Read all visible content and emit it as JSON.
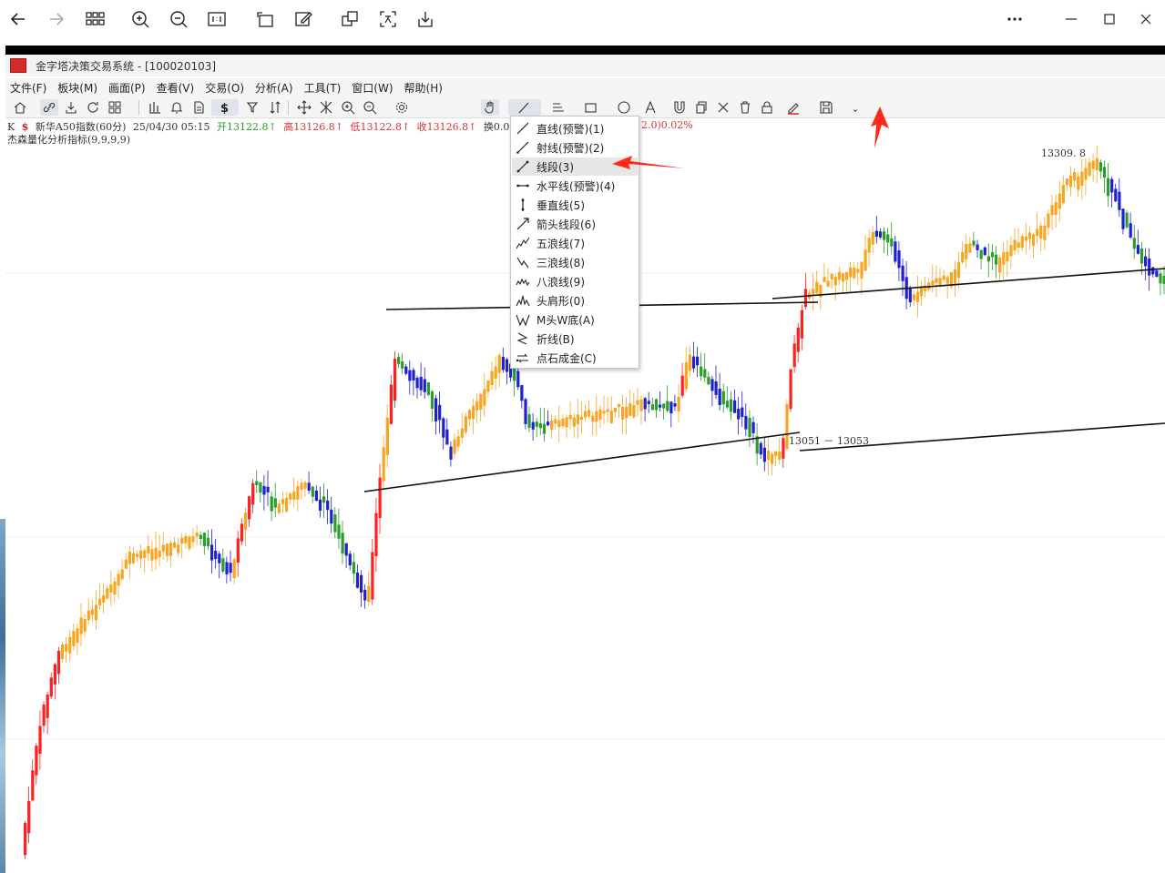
{
  "viewer": {
    "buttons": [
      "back",
      "forward",
      "grid",
      "zoom-in",
      "zoom-out",
      "actual-size",
      "rotate",
      "edit",
      "crop",
      "translate",
      "save",
      "more",
      "minimize",
      "maximize",
      "close"
    ]
  },
  "app": {
    "title": "金字塔决策交易系统 - [100020103]",
    "menu": [
      "文件(F)",
      "板块(M)",
      "画面(P)",
      "查看(V)",
      "交易(O)",
      "分析(A)",
      "工具(T)",
      "窗口(W)",
      "帮助(H)"
    ]
  },
  "info": {
    "k": "K",
    "dollar": "$",
    "name": "新华A50指数(60分)",
    "datetime": "25/04/30 05:15",
    "open": "开13122.8↑",
    "high": "高13126.8↑",
    "low": "低13122.8↑",
    "close": "收13126.8↑",
    "turnover": "换0.00%",
    "ext": "2.0)0.02%"
  },
  "indicator": "杰森量化分析指标(9,9,9,9)",
  "dropdown": {
    "items": [
      {
        "label": "直线(预警)(1)",
        "icon": "line-icon"
      },
      {
        "label": "射线(预警)(2)",
        "icon": "ray-icon"
      },
      {
        "label": "线段(3)",
        "icon": "segment-icon"
      },
      {
        "label": "水平线(预警)(4)",
        "icon": "horizontal-line-icon"
      },
      {
        "label": "垂直线(5)",
        "icon": "vertical-line-icon"
      },
      {
        "label": "箭头线段(6)",
        "icon": "arrow-segment-icon"
      },
      {
        "label": "五浪线(7)",
        "icon": "five-wave-icon"
      },
      {
        "label": "三浪线(8)",
        "icon": "three-wave-icon"
      },
      {
        "label": "八浪线(9)",
        "icon": "eight-wave-icon"
      },
      {
        "label": "头肩形(0)",
        "icon": "head-shoulders-icon"
      },
      {
        "label": "M头W底(A)",
        "icon": "m-top-w-bottom-icon"
      },
      {
        "label": "折线(B)",
        "icon": "polyline-icon"
      },
      {
        "label": "点石成金(C)",
        "icon": "golden-touch-icon"
      }
    ],
    "highlighted_index": 2
  },
  "chart_data": {
    "type": "candlestick",
    "annotations": [
      "13309. 8",
      "13051 － 13053"
    ],
    "colors": {
      "up": "#ff2020",
      "down": "#2020d0",
      "neutral_up": "#f5a623",
      "neutral_down": "#2a9d2a"
    },
    "price_range": [
      12800,
      13330
    ]
  }
}
